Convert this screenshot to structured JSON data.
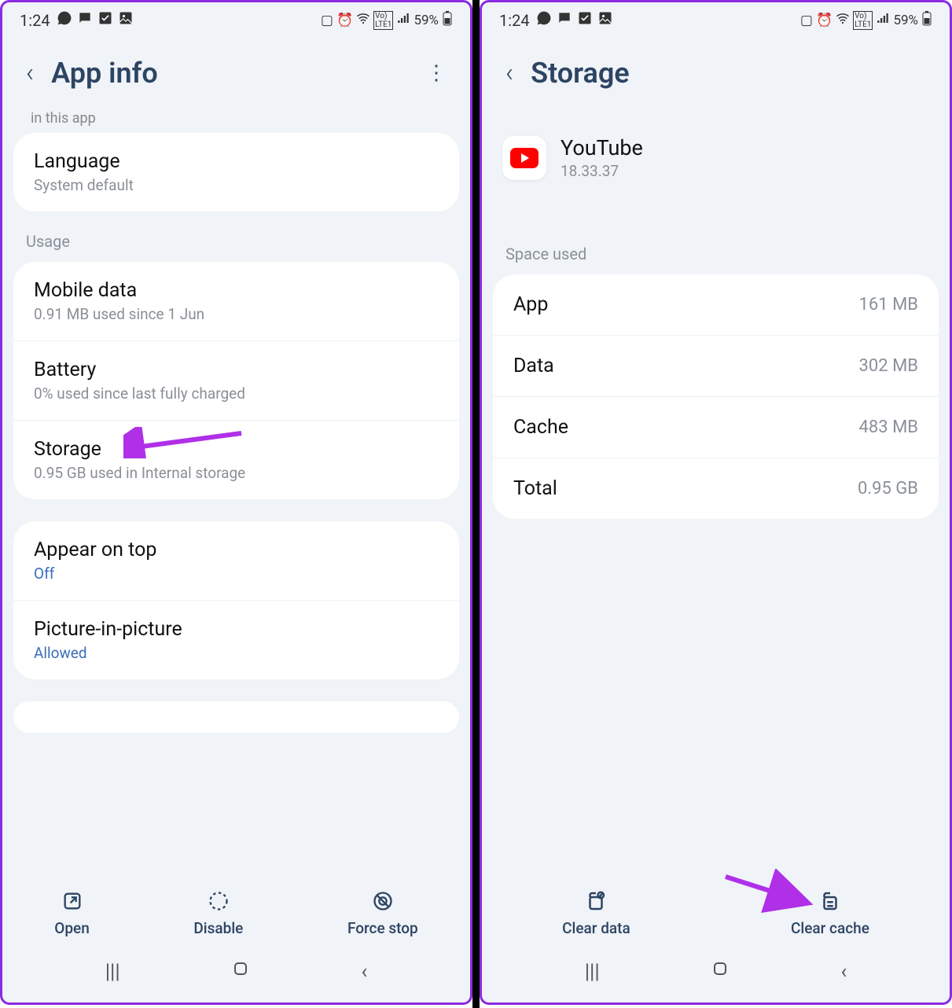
{
  "status": {
    "time": "1:24",
    "battery_text": "59%"
  },
  "left": {
    "header": "App info",
    "partial": "in this app",
    "language": {
      "title": "Language",
      "sub": "System default"
    },
    "usage_label": "Usage",
    "mobile": {
      "title": "Mobile data",
      "sub": "0.91 MB used since 1 Jun"
    },
    "battery": {
      "title": "Battery",
      "sub": "0% used since last fully charged"
    },
    "storage": {
      "title": "Storage",
      "sub": "0.95 GB used in Internal storage"
    },
    "appear": {
      "title": "Appear on top",
      "sub": "Off"
    },
    "pip": {
      "title": "Picture-in-picture",
      "sub": "Allowed"
    },
    "actions": {
      "open": "Open",
      "disable": "Disable",
      "force_stop": "Force stop"
    }
  },
  "right": {
    "header": "Storage",
    "app_name": "YouTube",
    "app_version": "18.33.37",
    "space_label": "Space used",
    "rows": {
      "app": {
        "label": "App",
        "value": "161 MB"
      },
      "data": {
        "label": "Data",
        "value": "302 MB"
      },
      "cache": {
        "label": "Cache",
        "value": "483 MB"
      },
      "total": {
        "label": "Total",
        "value": "0.95 GB"
      }
    },
    "actions": {
      "clear_data": "Clear data",
      "clear_cache": "Clear cache"
    }
  }
}
